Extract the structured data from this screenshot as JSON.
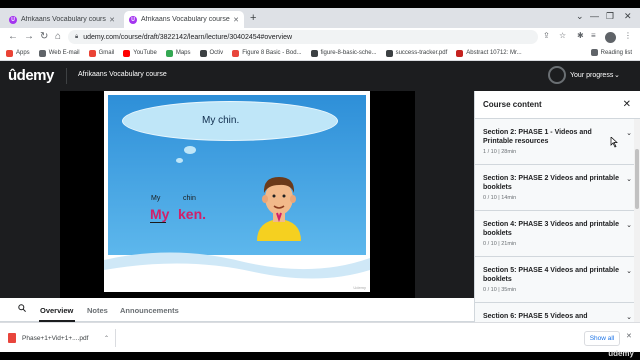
{
  "browser": {
    "tabs": [
      {
        "label": "Afrikaans Vocabulary course | Ud",
        "favicon": "U"
      },
      {
        "label": "Afrikaans Vocabulary course | Ud",
        "favicon": "U"
      }
    ],
    "new_tab_glyph": "+",
    "window_controls": [
      "⌄",
      "—",
      "❐",
      "✕"
    ],
    "url": "udemy.com/course/draft/3822142/learn/lecture/30402454#overview",
    "bookmarks": [
      {
        "label": "Apps",
        "color": "#ea4335"
      },
      {
        "label": "Web E-mail",
        "color": "#5f6368"
      },
      {
        "label": "Gmail",
        "color": "#ea4335"
      },
      {
        "label": "YouTube",
        "color": "#ff0000"
      },
      {
        "label": "Maps",
        "color": "#34a853"
      },
      {
        "label": "Octiv",
        "color": "#3c4043"
      },
      {
        "label": "Figure 8 Basic - Bod...",
        "color": "#e8453c"
      },
      {
        "label": "figure-8-basic-sche...",
        "color": "#3c4043"
      },
      {
        "label": "success-tracker.pdf",
        "color": "#3c4043"
      },
      {
        "label": "Abstract 10712: Mr...",
        "color": "#c5221f"
      }
    ],
    "reading_list": "Reading list"
  },
  "header": {
    "logo": "ûdemy",
    "course_title": "Afrikaans Vocabulary course",
    "progress_label": "Your progress"
  },
  "slide": {
    "cloud_text": "My chin.",
    "english_words": [
      "My",
      "chin"
    ],
    "afrikaans_words": [
      "My",
      "ken."
    ],
    "watermark": "Udemy"
  },
  "sidebar": {
    "title": "Course content",
    "sections": [
      {
        "title": "Section 2: PHASE 1 - Videos and Printable resources",
        "meta": "1 / 10 | 28min"
      },
      {
        "title": "Section 3: PHASE 2 Videos and printable booklets",
        "meta": "0 / 10 | 14min"
      },
      {
        "title": "Section 4: PHASE 3 Videos and printable booklets",
        "meta": "0 / 10 | 21min"
      },
      {
        "title": "Section 5: PHASE 4 Videos and printable booklets",
        "meta": "0 / 10 | 35min"
      },
      {
        "title": "Section 6: PHASE 5 Videos and",
        "meta": ""
      }
    ]
  },
  "lecture_tabs": [
    "Overview",
    "Notes",
    "Announcements"
  ],
  "downloads": {
    "file": "Phase+1+Vid+1+....pdf",
    "show_all": "Show all"
  },
  "corner_watermark": "udemy",
  "colors": {
    "udemy_dark": "#1c1d1f",
    "udemy_purple": "#a435f0",
    "slide_pink": "#d0206a",
    "sky_blue": "#2e8fd8",
    "link_blue": "#1a73e8"
  }
}
